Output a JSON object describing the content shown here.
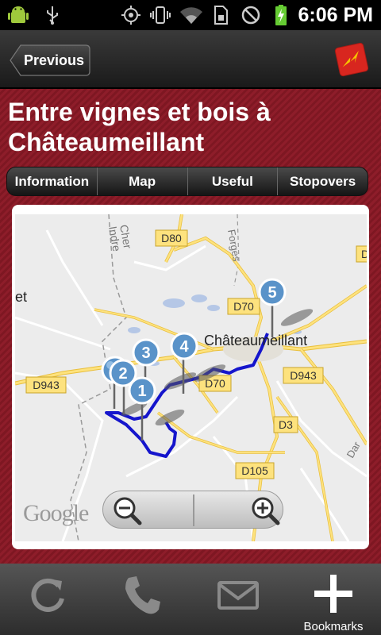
{
  "status_bar": {
    "time": "6:06 PM"
  },
  "header": {
    "previous_label": "Previous"
  },
  "title": "Entre vignes et bois à Châteaumeillant",
  "tabs": [
    "Information",
    "Map",
    "Useful",
    "Stopovers"
  ],
  "map": {
    "place_labels": [
      "Châteaumeillant",
      "et"
    ],
    "road_labels": [
      "D80",
      "D70",
      "D943",
      "D943",
      "D70",
      "D3",
      "D105",
      "D",
      "Cher",
      "Indre",
      "Forges",
      "Dar"
    ],
    "markers": [
      "1",
      "2",
      "3",
      "4",
      "5"
    ],
    "attribution": "Google"
  },
  "toolbar": {
    "bookmarks_label": "Bookmarks"
  },
  "colors": {
    "accent_red": "#8e1d2a",
    "route_blue": "#1010d0"
  }
}
